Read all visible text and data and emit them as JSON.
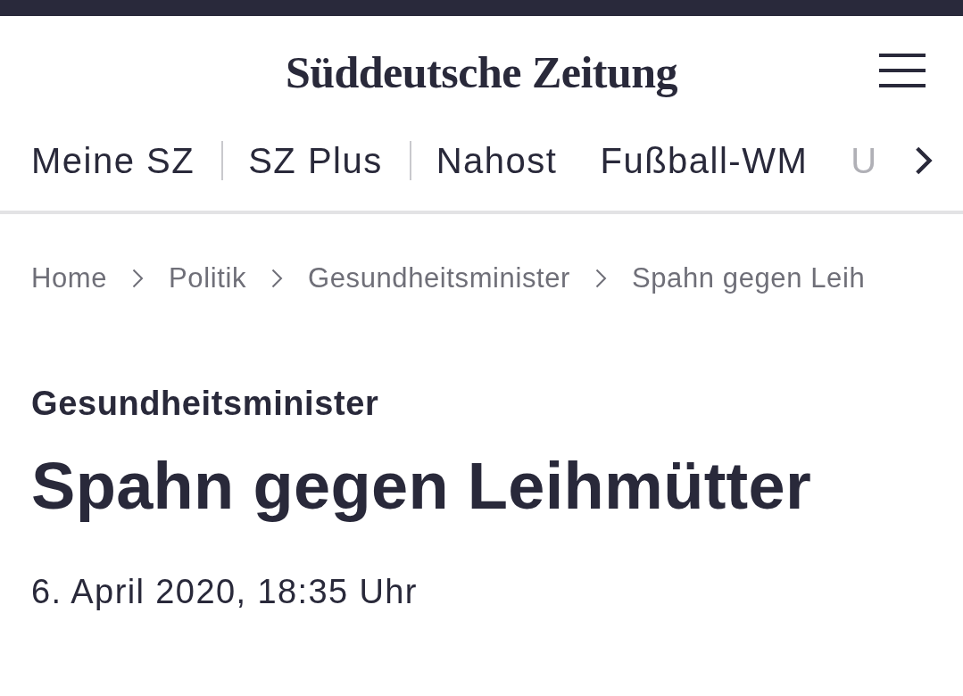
{
  "header": {
    "logo": "Süddeutsche Zeitung"
  },
  "nav": {
    "items": [
      {
        "label": "Meine SZ",
        "divider": true,
        "faded": false
      },
      {
        "label": "SZ Plus",
        "divider": true,
        "faded": false
      },
      {
        "label": "Nahost",
        "divider": false,
        "faded": false
      },
      {
        "label": "Fußball-WM",
        "divider": false,
        "faded": false
      },
      {
        "label": "U",
        "divider": false,
        "faded": true
      }
    ]
  },
  "breadcrumb": [
    "Home",
    "Politik",
    "Gesundheitsminister",
    "Spahn gegen Leih"
  ],
  "article": {
    "kicker": "Gesundheitsminister",
    "title": "Spahn gegen Leihmütter",
    "date": "6. April 2020, 18:35 Uhr"
  }
}
